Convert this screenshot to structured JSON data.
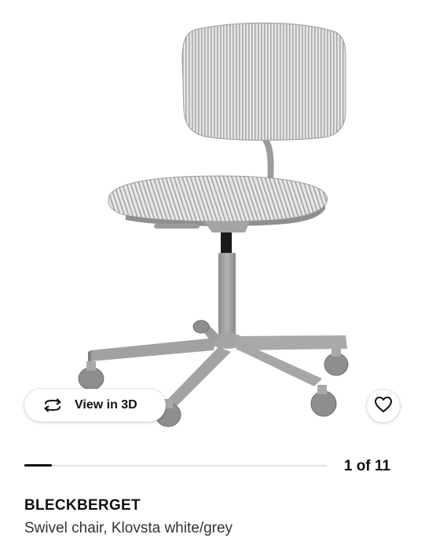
{
  "gallery": {
    "image_alt": "BLECKBERGET swivel chair product photo",
    "view3d_label": "View in 3D",
    "view3d_icon": "rotate-3d-icon",
    "favourite_icon": "heart-outline-icon",
    "current_image": 1,
    "total_images": 11,
    "counter_text": "1 of 11",
    "progress_fraction": 0.09
  },
  "product": {
    "name": "BLECKBERGET",
    "description": "Swivel chair, Klovsta white/grey"
  }
}
